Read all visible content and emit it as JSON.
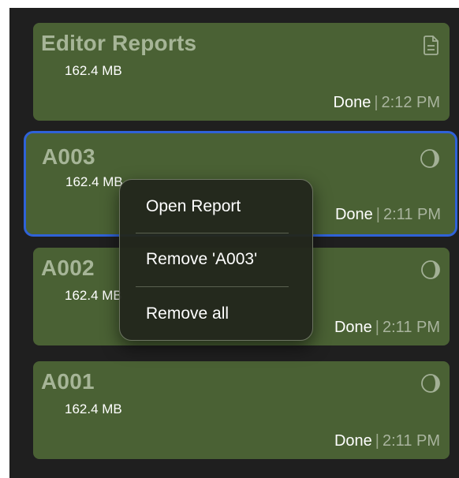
{
  "reports": [
    {
      "title": "Editor Reports",
      "size": "162.4 MB",
      "status": "Done",
      "separator": "|",
      "time": "2:12 PM",
      "icon": "document-icon"
    },
    {
      "title": "A003",
      "size": "162.4 MB",
      "status": "Done",
      "separator": "|",
      "time": "2:11 PM",
      "icon": "progress-circle-icon",
      "selected": true
    },
    {
      "title": "A002",
      "size": "162.4 MB",
      "status": "Done",
      "separator": "|",
      "time": "2:11 PM",
      "icon": "progress-circle-icon"
    },
    {
      "title": "A001",
      "size": "162.4 MB",
      "status": "Done",
      "separator": "|",
      "time": "2:11 PM",
      "icon": "progress-circle-icon"
    }
  ],
  "context_menu": {
    "items": [
      "Open Report",
      "Remove 'A003'",
      "Remove all"
    ]
  },
  "colors": {
    "card_bg": "#4a6134",
    "selection_border": "#2f62d8",
    "panel_bg": "#1f1f1f",
    "menu_bg": "#22261c"
  }
}
